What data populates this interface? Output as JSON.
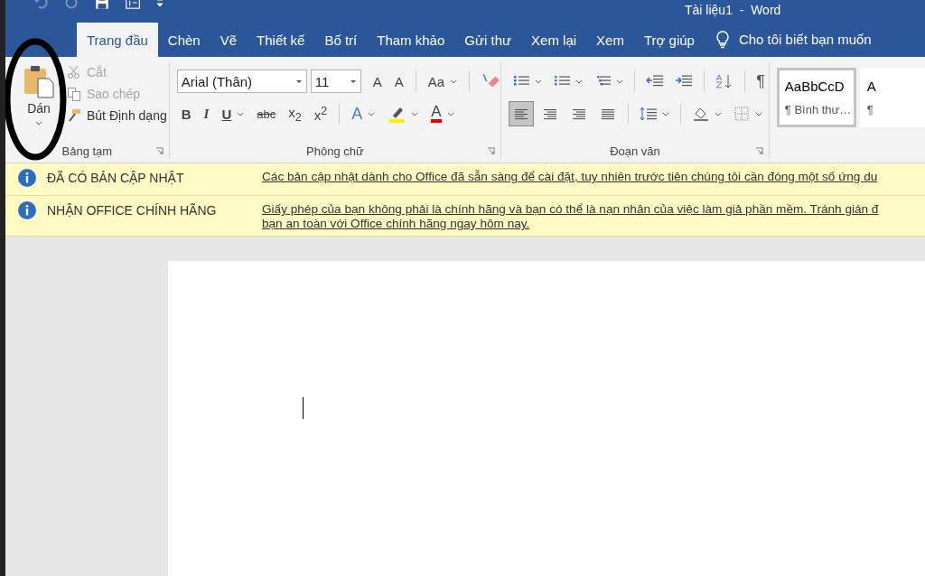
{
  "window": {
    "title": "Tài liệu1  -  Word"
  },
  "tabs": [
    {
      "label": "Trang đầu",
      "selected": true
    },
    {
      "label": "Chèn",
      "selected": false
    },
    {
      "label": "Vẽ",
      "selected": false
    },
    {
      "label": "Thiết kế",
      "selected": false
    },
    {
      "label": "Bố trí",
      "selected": false
    },
    {
      "label": "Tham khảo",
      "selected": false
    },
    {
      "label": "Gửi thư",
      "selected": false
    },
    {
      "label": "Xem lại",
      "selected": false
    },
    {
      "label": "Xem",
      "selected": false
    },
    {
      "label": "Trợ giúp",
      "selected": false
    }
  ],
  "tell_me": "Cho tôi biết bạn muốn",
  "clipboard": {
    "paste": "Dán",
    "items": [
      {
        "kind": "cut",
        "label": "Cắt",
        "disabled": true
      },
      {
        "kind": "copy",
        "label": "Sao chép",
        "disabled": true
      },
      {
        "kind": "painter",
        "label": "Bút Định dạng",
        "disabled": false
      }
    ],
    "group": "Bảng tạm"
  },
  "font": {
    "name": "Arial (Thân)",
    "size": "11",
    "group": "Phông chữ",
    "row1": [
      {
        "kind": "text",
        "label": "A",
        "caret": false
      },
      {
        "kind": "text",
        "label": "A",
        "caret": false
      },
      {
        "kind": "sep"
      },
      {
        "kind": "text",
        "label": "Aa",
        "caret": true
      },
      {
        "kind": "sep"
      },
      {
        "kind": "eraser"
      }
    ],
    "row2": [
      {
        "kind": "bold",
        "label": "B",
        "caret": false
      },
      {
        "kind": "italic",
        "label": "I",
        "caret": false
      },
      {
        "kind": "underline",
        "label": "U",
        "caret": true
      },
      {
        "kind": "strike",
        "label": "abc",
        "caret": false
      },
      {
        "kind": "text",
        "label": "x$_{2}$",
        "caret": false
      },
      {
        "kind": "text",
        "label": "x$^{2}$",
        "caret": false
      },
      {
        "kind": "sep"
      },
      {
        "kind": "effect",
        "label": "A",
        "caret": true
      },
      {
        "kind": "highlight",
        "caret": true
      },
      {
        "kind": "fontcolor",
        "label": "A",
        "caret": true
      }
    ]
  },
  "paragraph": {
    "group": "Đoạn văn",
    "row1": [
      {
        "kind": "bullets",
        "caret": true,
        "selected": false
      },
      {
        "kind": "numbering",
        "caret": true,
        "selected": false
      },
      {
        "kind": "multilevel",
        "caret": true,
        "selected": false
      },
      {
        "kind": "sep"
      },
      {
        "kind": "outdent",
        "caret": false,
        "selected": false
      },
      {
        "kind": "indent",
        "caret": false,
        "selected": false
      },
      {
        "kind": "sep"
      },
      {
        "kind": "sort",
        "caret": false,
        "selected": false
      },
      {
        "kind": "sep"
      },
      {
        "kind": "pilcrow",
        "label": "¶",
        "caret": false,
        "selected": false
      }
    ],
    "row2": [
      {
        "kind": "align-left",
        "caret": false,
        "selected": true
      },
      {
        "kind": "align-center",
        "caret": false,
        "selected": false
      },
      {
        "kind": "align-right",
        "caret": false,
        "selected": false
      },
      {
        "kind": "justify",
        "caret": false,
        "selected": false
      },
      {
        "kind": "sep"
      },
      {
        "kind": "spacing",
        "caret": true,
        "selected": false
      },
      {
        "kind": "sep"
      },
      {
        "kind": "shading",
        "caret": true,
        "selected": false
      },
      {
        "kind": "borders",
        "caret": true,
        "selected": false
      }
    ]
  },
  "styles": [
    {
      "sample": "AaBbCcD",
      "name": "¶ Bình thư…",
      "selected": true
    },
    {
      "sample": "A",
      "name": "¶",
      "selected": false
    }
  ],
  "messages": [
    {
      "title": "ĐÃ CÓ BẢN CẬP NHẬT",
      "lines": [
        "Các bản cập nhật dành cho Office đã sẵn sàng để cài đặt, tuy nhiên trước tiên chúng tôi cần đóng một số ứng du"
      ]
    },
    {
      "title": "NHẬN OFFICE CHÍNH HÃNG",
      "lines": [
        "Giấy phép của bạn không phải là chính hãng và bạn có thể là nạn nhân của việc làm giả phần mềm. Tránh gián đ",
        "bạn an toàn với Office chính hãng ngay hôm nay."
      ]
    }
  ]
}
